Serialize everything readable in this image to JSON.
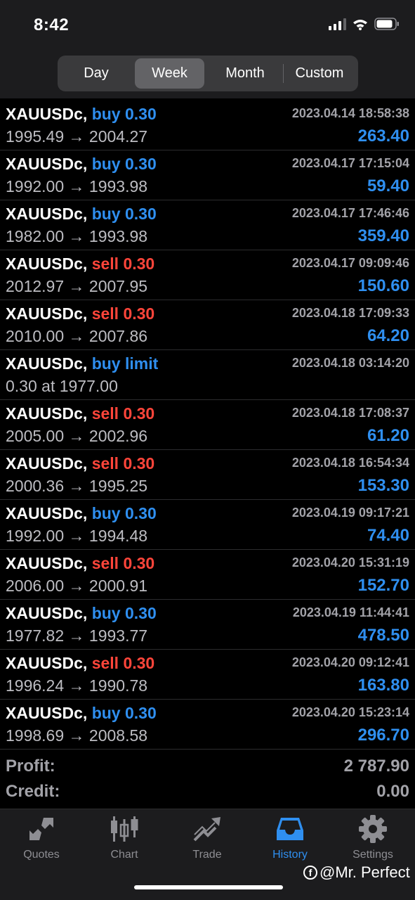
{
  "status_bar": {
    "time": "8:42"
  },
  "period_tabs": [
    {
      "label": "Day",
      "active": false
    },
    {
      "label": "Week",
      "active": true
    },
    {
      "label": "Month",
      "active": false
    },
    {
      "label": "Custom",
      "active": false
    }
  ],
  "history": [
    {
      "symbol": "XAUUSDc",
      "sep": ",",
      "action": "buy 0.30",
      "side": "buy",
      "time": "2023.04.14 18:58:38",
      "prices": "1995.49 → 2004.27",
      "profit": "263.40"
    },
    {
      "symbol": "XAUUSDc",
      "sep": ",",
      "action": "buy 0.30",
      "side": "buy",
      "time": "2023.04.17 17:15:04",
      "prices": "1992.00 → 1993.98",
      "profit": "59.40"
    },
    {
      "symbol": "XAUUSDc",
      "sep": ",",
      "action": "buy 0.30",
      "side": "buy",
      "time": "2023.04.17 17:46:46",
      "prices": "1982.00 → 1993.98",
      "profit": "359.40"
    },
    {
      "symbol": "XAUUSDc",
      "sep": ",",
      "action": "sell 0.30",
      "side": "sell",
      "time": "2023.04.17 09:09:46",
      "prices": "2012.97 → 2007.95",
      "profit": "150.60"
    },
    {
      "symbol": "XAUUSDc",
      "sep": ",",
      "action": "sell 0.30",
      "side": "sell",
      "time": "2023.04.18 17:09:33",
      "prices": "2010.00 → 2007.86",
      "profit": "64.20"
    },
    {
      "symbol": "XAUUSDc",
      "sep": ",",
      "action": "buy limit",
      "side": "buy",
      "time": "2023.04.18 03:14:20",
      "prices": "0.30 at 1977.00",
      "profit": ""
    },
    {
      "symbol": "XAUUSDc",
      "sep": ",",
      "action": "sell 0.30",
      "side": "sell",
      "time": "2023.04.18 17:08:37",
      "prices": "2005.00 → 2002.96",
      "profit": "61.20"
    },
    {
      "symbol": "XAUUSDc",
      "sep": ",",
      "action": "sell 0.30",
      "side": "sell",
      "time": "2023.04.18 16:54:34",
      "prices": "2000.36 → 1995.25",
      "profit": "153.30"
    },
    {
      "symbol": "XAUUSDc",
      "sep": ",",
      "action": "buy 0.30",
      "side": "buy",
      "time": "2023.04.19 09:17:21",
      "prices": "1992.00 → 1994.48",
      "profit": "74.40"
    },
    {
      "symbol": "XAUUSDc",
      "sep": ",",
      "action": "sell 0.30",
      "side": "sell",
      "time": "2023.04.20 15:31:19",
      "prices": "2006.00 → 2000.91",
      "profit": "152.70"
    },
    {
      "symbol": "XAUUSDc",
      "sep": ",",
      "action": "buy 0.30",
      "side": "buy",
      "time": "2023.04.19 11:44:41",
      "prices": "1977.82 → 1993.77",
      "profit": "478.50"
    },
    {
      "symbol": "XAUUSDc",
      "sep": ",",
      "action": "sell 0.30",
      "side": "sell",
      "time": "2023.04.20 09:12:41",
      "prices": "1996.24 → 1990.78",
      "profit": "163.80"
    },
    {
      "symbol": "XAUUSDc",
      "sep": ",",
      "action": "buy 0.30",
      "side": "buy",
      "time": "2023.04.20 15:23:14",
      "prices": "1998.69 → 2008.58",
      "profit": "296.70"
    }
  ],
  "summary": {
    "profit_label": "Profit:",
    "profit_value": "2 787.90",
    "credit_label": "Credit:",
    "credit_value": "0.00"
  },
  "tabbar": [
    {
      "label": "Quotes",
      "icon": "quotes-icon",
      "active": false
    },
    {
      "label": "Chart",
      "icon": "chart-icon",
      "active": false
    },
    {
      "label": "Trade",
      "icon": "trade-icon",
      "active": false
    },
    {
      "label": "History",
      "icon": "history-icon",
      "active": true
    },
    {
      "label": "Settings",
      "icon": "settings-icon",
      "active": false
    }
  ],
  "watermark": {
    "text": "@Mr. Perfect",
    "icon": "facebook-icon"
  },
  "colors": {
    "buy": "#2f8ff0",
    "sell": "#ff453a",
    "active_tab": "#2f8ff0",
    "inactive_tab": "#8e8e93"
  }
}
